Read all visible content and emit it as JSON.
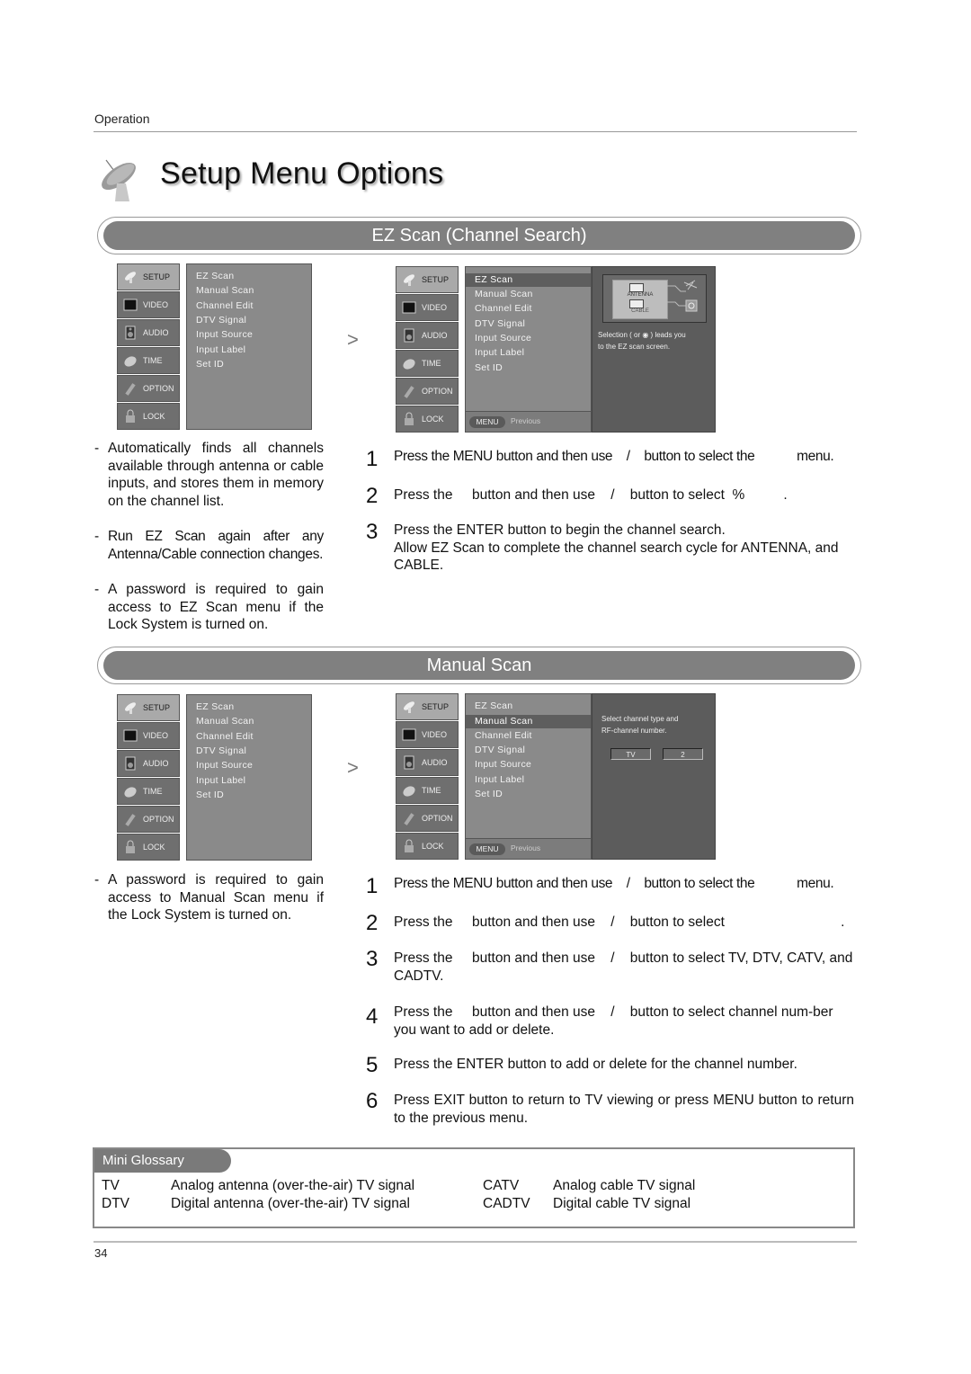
{
  "header": {
    "section": "Operation",
    "title": "Setup Menu Options"
  },
  "sections": {
    "ez_scan": {
      "title": "EZ Scan (Channel Search)"
    },
    "manual_scan": {
      "title": "Manual Scan"
    }
  },
  "tv_menu": {
    "side_items": [
      "SETUP",
      "VIDEO",
      "AUDIO",
      "TIME",
      "OPTION",
      "LOCK"
    ],
    "setup_items": [
      "EZ Scan",
      "Manual Scan",
      "Channel Edit",
      "DTV Signal",
      "Input Source",
      "Input Label",
      "Set ID"
    ],
    "menu_button": "MENU",
    "previous_label": "Previous"
  },
  "ez_screen": {
    "selected_item": "EZ Scan",
    "antenna_label": "ANTENNA",
    "cable_label": "CABLE",
    "info_line1": "Selection (    or ◉ ) leads you",
    "info_line2": "to the EZ scan screen."
  },
  "manual_screen": {
    "selected_item": "Manual Scan",
    "info_line1": "Select channel type and",
    "info_line2": "RF-channel number.",
    "channel_type": "TV",
    "channel_number": "2"
  },
  "arrow_glyph": ">",
  "ez_notes": [
    "Automatically finds all channels available through antenna or cable inputs, and stores them in memory on the channel list.",
    "Run EZ Scan again after any Antenna/Cable connection changes.",
    " A password is required to gain access to EZ Scan menu if the Lock System is turned on."
  ],
  "ez_steps": [
    {
      "num": "1",
      "text": "Press the MENU button and then use    /    button to select the            menu."
    },
    {
      "num": "2",
      "text": "Press the     button and then use    /    button to select  %          ."
    },
    {
      "num": "3",
      "text": "Press the ENTER button to begin the channel search.\nAllow EZ Scan to complete the channel search cycle for ANTENNA, and CABLE."
    }
  ],
  "manual_notes": [
    " A password is required to gain access to Manual Scan menu if the Lock System is turned on."
  ],
  "manual_steps": [
    {
      "num": "1",
      "text": "Press the MENU button and then use    /    button to select the            menu."
    },
    {
      "num": "2",
      "text": "Press the     button and then use    /    button to select                              ."
    },
    {
      "num": "3",
      "text": "Press the     button and then use    /    button to select TV, DTV, CATV, and CADTV."
    },
    {
      "num": "4",
      "text": "Press the     button and then use    /    button to select channel num-ber you want to add or delete."
    },
    {
      "num": "5",
      "text": "Press the ENTER button to add or delete for the channel number."
    },
    {
      "num": "6",
      "text": "Press EXIT button to return to TV viewing or press MENU button to return to the previous menu."
    }
  ],
  "glossary": {
    "title": "Mini Glossary",
    "entries": [
      {
        "term": "TV",
        "definition": "Analog antenna (over-the-air) TV signal"
      },
      {
        "term": "DTV",
        "definition": "Digital antenna (over-the-air) TV signal"
      },
      {
        "term": "CATV",
        "definition": "Analog cable TV signal"
      },
      {
        "term": "CADTV",
        "definition": "Digital cable TV signal"
      }
    ]
  },
  "footer": {
    "page_number": "34"
  }
}
